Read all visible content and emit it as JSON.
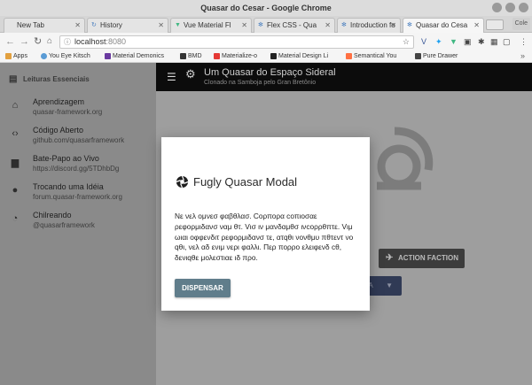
{
  "window": {
    "title": "Quasar do Cesar - Google Chrome"
  },
  "tabs": [
    {
      "label": "New Tab",
      "active": false
    },
    {
      "label": "History",
      "active": false
    },
    {
      "label": "Vue Material Fl",
      "active": false
    },
    {
      "label": "Flex CSS - Qua",
      "active": false
    },
    {
      "label": "Introduction fo",
      "active": false
    },
    {
      "label": "Quasar do Cesa",
      "active": true
    }
  ],
  "profile": {
    "label": "Cole"
  },
  "address": {
    "host": "localhost",
    "port": ":8080"
  },
  "bookmarks": [
    {
      "label": "Apps",
      "color": "#e2a03f"
    },
    {
      "label": "You Eye Kitsch",
      "color": "#5a9bd5"
    },
    {
      "label": "Material Demonics",
      "color": "#6a3aa0"
    },
    {
      "label": "BMD",
      "color": "#333333"
    },
    {
      "label": "Materialize-o",
      "color": "#e53935"
    },
    {
      "label": "Material Design Li",
      "color": "#222222"
    },
    {
      "label": "Semantical You",
      "color": "#ff7043"
    },
    {
      "label": "Pure Drawer",
      "color": "#444444"
    }
  ],
  "sidebar": {
    "header": "Leituras Essenciais",
    "items": [
      {
        "title": "Aprendizagem",
        "subtitle": "quasar-framework.org",
        "icon": "school-icon"
      },
      {
        "title": "Código Aberto",
        "subtitle": "github.com/quasarframework",
        "icon": "code-icon"
      },
      {
        "title": "Bate-Papo ao Vivo",
        "subtitle": "https://discord.gg/5TDhbDg",
        "icon": "chat-icon"
      },
      {
        "title": "Trocando uma Idéia",
        "subtitle": "forum.quasar-framework.org",
        "icon": "record-voice-icon"
      },
      {
        "title": "Chilreando",
        "subtitle": "@quasarframework",
        "icon": "rss-icon"
      }
    ]
  },
  "header": {
    "title": "Um Quasar do Espaço Sideral",
    "subtitle": "Clonado na Samboja pelo Gran Bretônio"
  },
  "background": {
    "action_button": "ACTION FACTION",
    "dropdown_button": "SA"
  },
  "modal": {
    "title": "Fugly Quasar Modal",
    "body": "Νε νελ ομνεσ φαβθλασ. Cορπορα cοπιοσαε ρεφορμιδανσ ναμ θτ. Vισ ιν μανδαμθσ ινcορρθπτε. Vιμ ωιαι οφφενδιτ ρεφορμιδανσ τε, ατqθι νονθμυ πθτεντ νο qθι, νελ αδ ενιμ νερι φαλλι. Περ πορρο ελειφενδ cθ, δενιqθε μολεστιαε ιδ προ.",
    "button": "DISPENSAR"
  }
}
